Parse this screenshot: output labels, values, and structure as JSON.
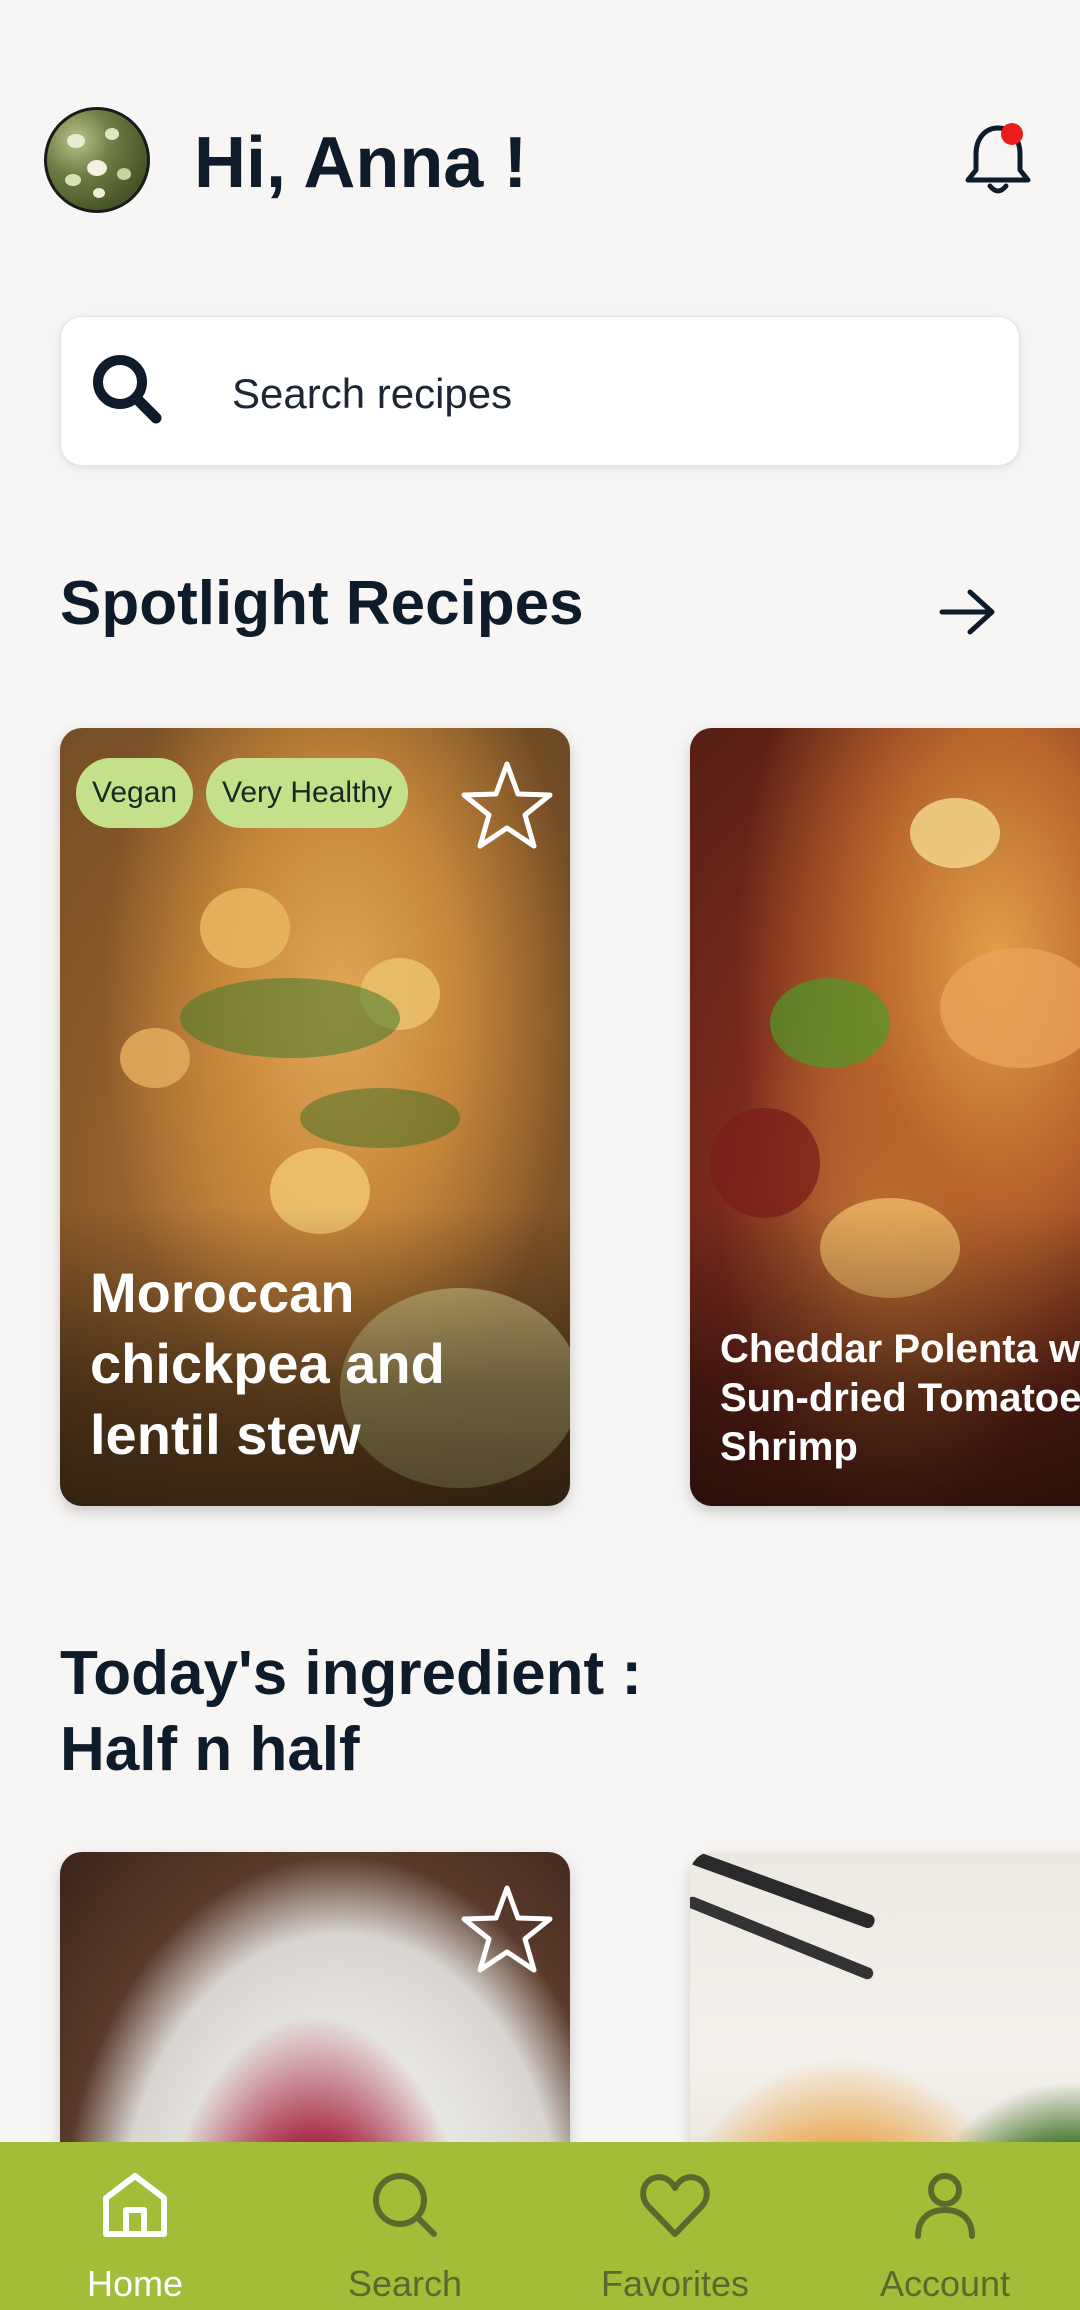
{
  "header": {
    "greeting": "Hi, Anna !"
  },
  "search": {
    "placeholder": "Search recipes"
  },
  "spotlight": {
    "title": "Spotlight Recipes",
    "cards": [
      {
        "title": "Moroccan chickpea and lentil stew",
        "tags": [
          "Vegan",
          "Very Healthy"
        ],
        "favorited": false
      },
      {
        "title": "Cheddar Polenta with Sun-dried Tomatoes and Shrimp",
        "title_lines": [
          "Cheddar Polenta wi",
          "Sun-dried Tomatoe",
          "Shrimp"
        ]
      }
    ]
  },
  "ingredient": {
    "title_line1": "Today's ingredient :",
    "title_line2": "Half n half"
  },
  "nav": {
    "items": [
      {
        "label": "Home",
        "icon": "home-icon",
        "active": true
      },
      {
        "label": "Search",
        "icon": "search-icon",
        "active": false
      },
      {
        "label": "Favorites",
        "icon": "heart-icon",
        "active": false
      },
      {
        "label": "Account",
        "icon": "person-icon",
        "active": false
      }
    ]
  },
  "colors": {
    "nav_background": "#a2be39",
    "tag_background": "#c5e08a",
    "notification_dot": "#ea1c1c",
    "active_nav": "#ffffff",
    "inactive_nav": "#5a6a2c"
  }
}
